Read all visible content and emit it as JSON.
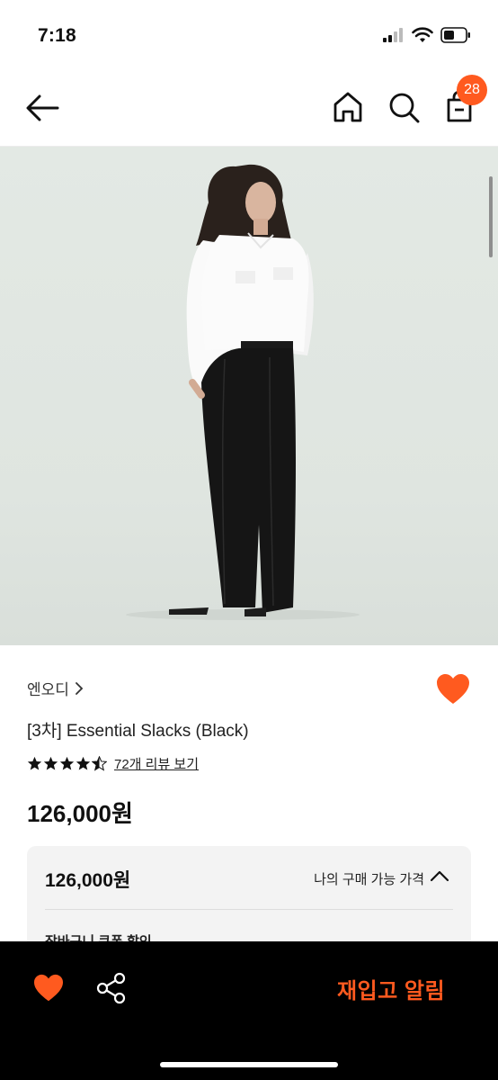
{
  "status": {
    "time": "7:18"
  },
  "header": {
    "back_icon": "arrow-left-icon",
    "home_icon": "home-icon",
    "search_icon": "search-icon",
    "cart_icon": "shopping-bag-icon",
    "cart_count": "28"
  },
  "product": {
    "brand": "엔오디",
    "title": "[3차] Essential Slacks (Black)",
    "rating": 4.5,
    "review_link": "72개 리뷰 보기",
    "price": "126,000원",
    "liked": true
  },
  "price_box": {
    "price": "126,000원",
    "label": "나의 구매 가능 가격",
    "sub_label": "장바구니 쿠폰 할인"
  },
  "bottom_bar": {
    "restock_label": "재입고 알림"
  },
  "colors": {
    "accent": "#ff5a1f",
    "bar": "#000000"
  }
}
